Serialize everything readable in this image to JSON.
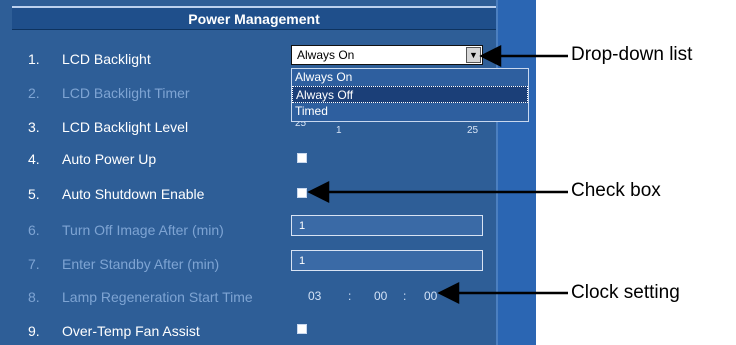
{
  "panel": {
    "title": "Power Management",
    "rows": [
      {
        "num": "1.",
        "label": "LCD Backlight",
        "enabled": true
      },
      {
        "num": "2.",
        "label": "LCD Backlight Timer",
        "enabled": false
      },
      {
        "num": "3.",
        "label": "LCD Backlight Level",
        "enabled": true
      },
      {
        "num": "4.",
        "label": "Auto Power Up",
        "enabled": true
      },
      {
        "num": "5.",
        "label": "Auto Shutdown Enable",
        "enabled": true
      },
      {
        "num": "6.",
        "label": "Turn Off Image After (min)",
        "enabled": false
      },
      {
        "num": "7.",
        "label": "Enter Standby After (min)",
        "enabled": false
      },
      {
        "num": "8.",
        "label": "Lamp Regeneration Start Time",
        "enabled": false
      },
      {
        "num": "9.",
        "label": "Over-Temp Fan Assist",
        "enabled": true
      }
    ]
  },
  "backlight_dropdown": {
    "value": "Always On",
    "options": [
      "Always On",
      "Always Off",
      "Timed"
    ],
    "highlighted": "Always Off"
  },
  "backlight_level": {
    "value": "25",
    "min": "1",
    "max": "25"
  },
  "turn_off_image_after": "1",
  "enter_standby_after": "1",
  "lamp_regeneration_time": {
    "hours": "03",
    "minutes": "00",
    "seconds": "00",
    "sep": ":"
  },
  "callouts": {
    "dropdown": "Drop-down list",
    "checkbox": "Check box",
    "clock": "Clock setting"
  }
}
